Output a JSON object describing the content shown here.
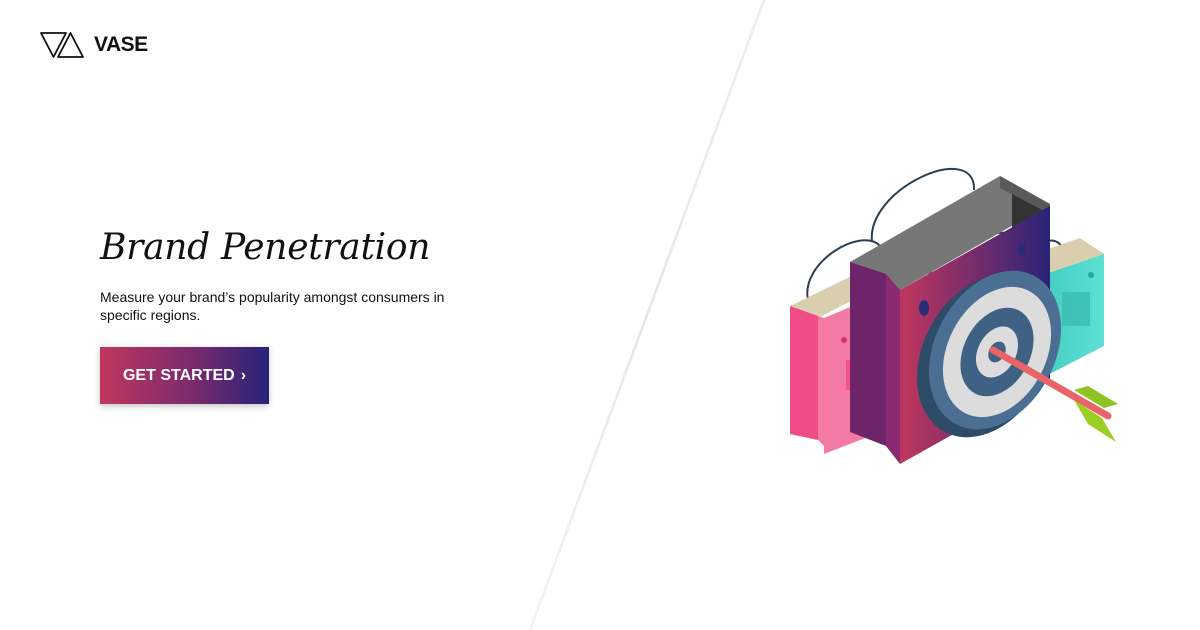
{
  "brand": {
    "name": "VASE"
  },
  "hero": {
    "title": "Brand Penetration",
    "description": "Measure your brand’s popularity amongst consumers in specific regions."
  },
  "cta": {
    "label": "GET STARTED",
    "icon": "chevron-right-icon",
    "chevron": "›",
    "gradient_start": "#c0375f",
    "gradient_end": "#26237a"
  },
  "illustration": {
    "subject": "shopping-bags-with-target-and-arrow"
  }
}
